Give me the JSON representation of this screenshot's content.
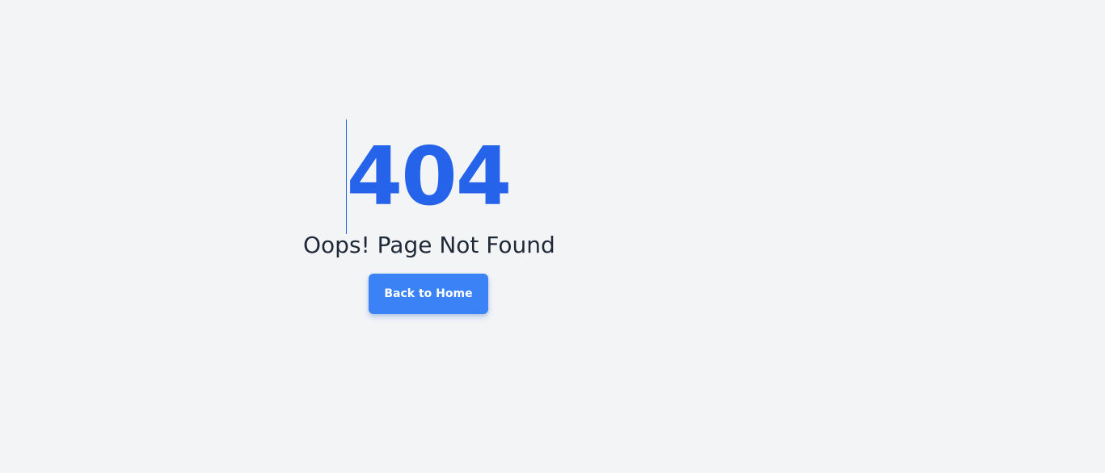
{
  "error_page": {
    "code": "404",
    "title": "Oops! Page Not Found",
    "home_button_label": "Back to Home"
  },
  "colors": {
    "background": "#f3f4f6",
    "code": "#2563eb",
    "title": "#1f2937",
    "button": "#3b82f6",
    "button_text": "#ffffff"
  }
}
